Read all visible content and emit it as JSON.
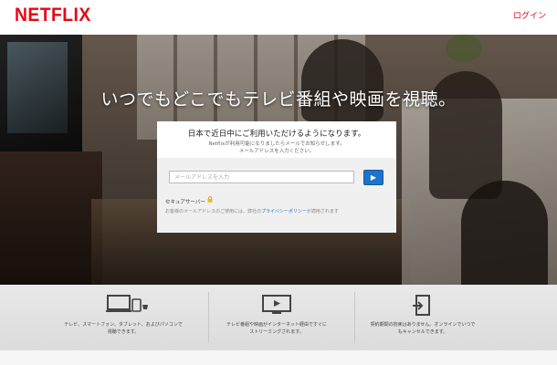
{
  "header": {
    "logo": "NETFLIX",
    "login": "ログイン"
  },
  "hero": {
    "headline": "いつでもどこでもテレビ番組や映画を視聴。"
  },
  "signup": {
    "title": "日本で近日中にご利用いただけるようになります。",
    "subtitle_line1": "Netflixが利用可能になりましたらメールでお知らせします。",
    "subtitle_line2": "メールアドレスを入力ください。",
    "email_placeholder": "メールアドレスを入力",
    "submit_label": "▶",
    "secure_label": "セキュアサーバー",
    "notice_prefix": "お客様のメールアドレスのご使用には、弊社の",
    "privacy_link": "プライバシーポリシー",
    "notice_suffix": "が適用されます"
  },
  "features": [
    {
      "icon": "devices-icon",
      "line1": "テレビ、スマートフォン、タブレット、およびパソコンで",
      "line2": "視聴できます。"
    },
    {
      "icon": "tv-icon",
      "line1": "テレビ番組や映画がインターネット経由ですぐに",
      "line2": "ストリーミングされます。"
    },
    {
      "icon": "exit-door-icon",
      "line1": "契約期間の拘束はありません。オンラインでいつで",
      "line2": "もキャンセルできます。"
    }
  ],
  "colors": {
    "brand_red": "#e50914",
    "button_blue": "#1e73c9"
  }
}
